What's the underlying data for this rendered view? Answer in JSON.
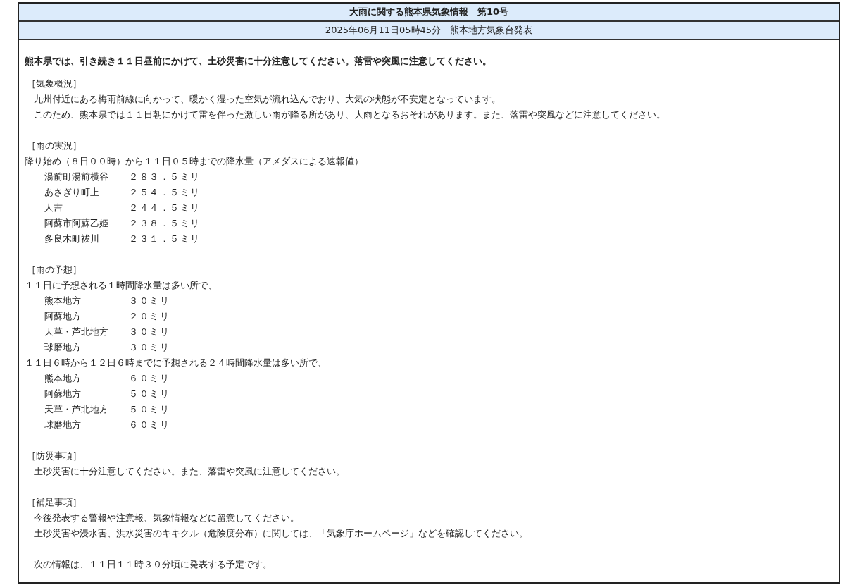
{
  "title": "大雨に関する熊本県気象情報　第10号",
  "issued": "2025年06月11日05時45分　熊本地方気象台発表",
  "headline": "熊本県では、引き続き１１日昼前にかけて、土砂災害に十分注意してください。落雷や突風に注意してください。",
  "sections": [
    {
      "heading": "［気象概況］",
      "items": [
        {
          "kind": "para",
          "text": "九州付近にある梅雨前線に向かって、暖かく湿った空気が流れ込んでおり、大気の状態が不安定となっています。"
        },
        {
          "kind": "para",
          "text": "このため、熊本県では１１日朝にかけて雷を伴った激しい雨が降る所があり、大雨となるおそれがあります。また、落雷や突風などに注意してください。"
        }
      ]
    },
    {
      "heading": "［雨の実況］",
      "items": [
        {
          "kind": "intro",
          "text": "降り始め（８日００時）から１１日０５時までの降水量（アメダスによる速報値）"
        },
        {
          "kind": "table",
          "rows": [
            [
              "湯前町湯前横谷",
              "２８３．５ミリ"
            ],
            [
              "あさぎり町上",
              "２５４．５ミリ"
            ],
            [
              "人吉",
              "２４４．５ミリ"
            ],
            [
              "阿蘇市阿蘇乙姫",
              "２３８．５ミリ"
            ],
            [
              "多良木町祓川",
              "２３１．５ミリ"
            ]
          ]
        }
      ]
    },
    {
      "heading": "［雨の予想］",
      "items": [
        {
          "kind": "intro",
          "text": "１１日に予想される１時間降水量は多い所で、"
        },
        {
          "kind": "table",
          "rows": [
            [
              "熊本地方",
              "３０ミリ"
            ],
            [
              "阿蘇地方",
              "２０ミリ"
            ],
            [
              "天草・芦北地方",
              "３０ミリ"
            ],
            [
              "球磨地方",
              "３０ミリ"
            ]
          ]
        },
        {
          "kind": "intro",
          "text": "１１日６時から１２日６時までに予想される２４時間降水量は多い所で、"
        },
        {
          "kind": "table",
          "rows": [
            [
              "熊本地方",
              "６０ミリ"
            ],
            [
              "阿蘇地方",
              "５０ミリ"
            ],
            [
              "天草・芦北地方",
              "５０ミリ"
            ],
            [
              "球磨地方",
              "６０ミリ"
            ]
          ]
        }
      ]
    },
    {
      "heading": "［防災事項］",
      "items": [
        {
          "kind": "para",
          "text": "土砂災害に十分注意してください。また、落雷や突風に注意してください。"
        }
      ]
    },
    {
      "heading": "［補足事項］",
      "items": [
        {
          "kind": "para",
          "text": "今後発表する警報や注意報、気象情報などに留意してください。"
        },
        {
          "kind": "para",
          "text": "土砂災害や浸水害、洪水災害のキキクル（危険度分布）に関しては、「気象庁ホームページ」などを確認してください。"
        }
      ]
    },
    {
      "items": [
        {
          "kind": "para",
          "text": "次の情報は、１１日１１時３０分頃に発表する予定です。"
        }
      ]
    }
  ]
}
